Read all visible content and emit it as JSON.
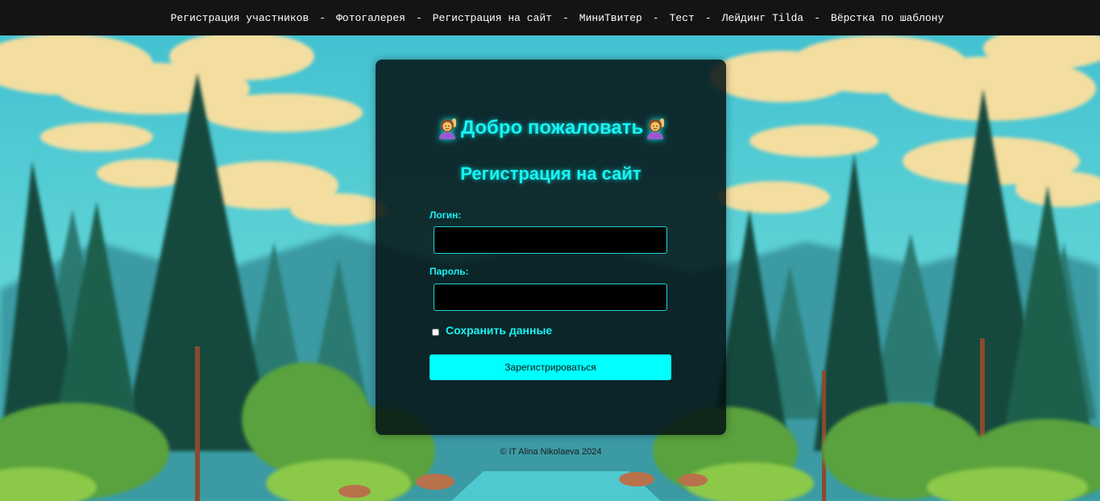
{
  "nav": {
    "items": [
      {
        "label": "Регистрация участников"
      },
      {
        "label": "Фотогалерея"
      },
      {
        "label": "Регистрация на сайт"
      },
      {
        "label": "МиниТвитер"
      },
      {
        "label": "Тест"
      },
      {
        "label": "Лейдинг Tilda"
      },
      {
        "label": "Вёрстка по шаблону"
      }
    ],
    "separator": "-"
  },
  "card": {
    "welcome": "Добро пожаловать",
    "welcome_emoji": "person-raising-hand-icon",
    "title": "Регистрация на сайт",
    "login_label": "Логин:",
    "login_value": "",
    "password_label": "Пароль:",
    "password_value": "",
    "remember_label": "Сохранить данные",
    "remember_checked": false,
    "submit_label": "Зарегистрироваться"
  },
  "footer": {
    "text": "© iT Alina Nikolaeva 2024"
  },
  "colors": {
    "accent": "#19f3f3",
    "button_bg": "#00ffff",
    "nav_bg": "#141414",
    "card_bg": "#041214"
  }
}
